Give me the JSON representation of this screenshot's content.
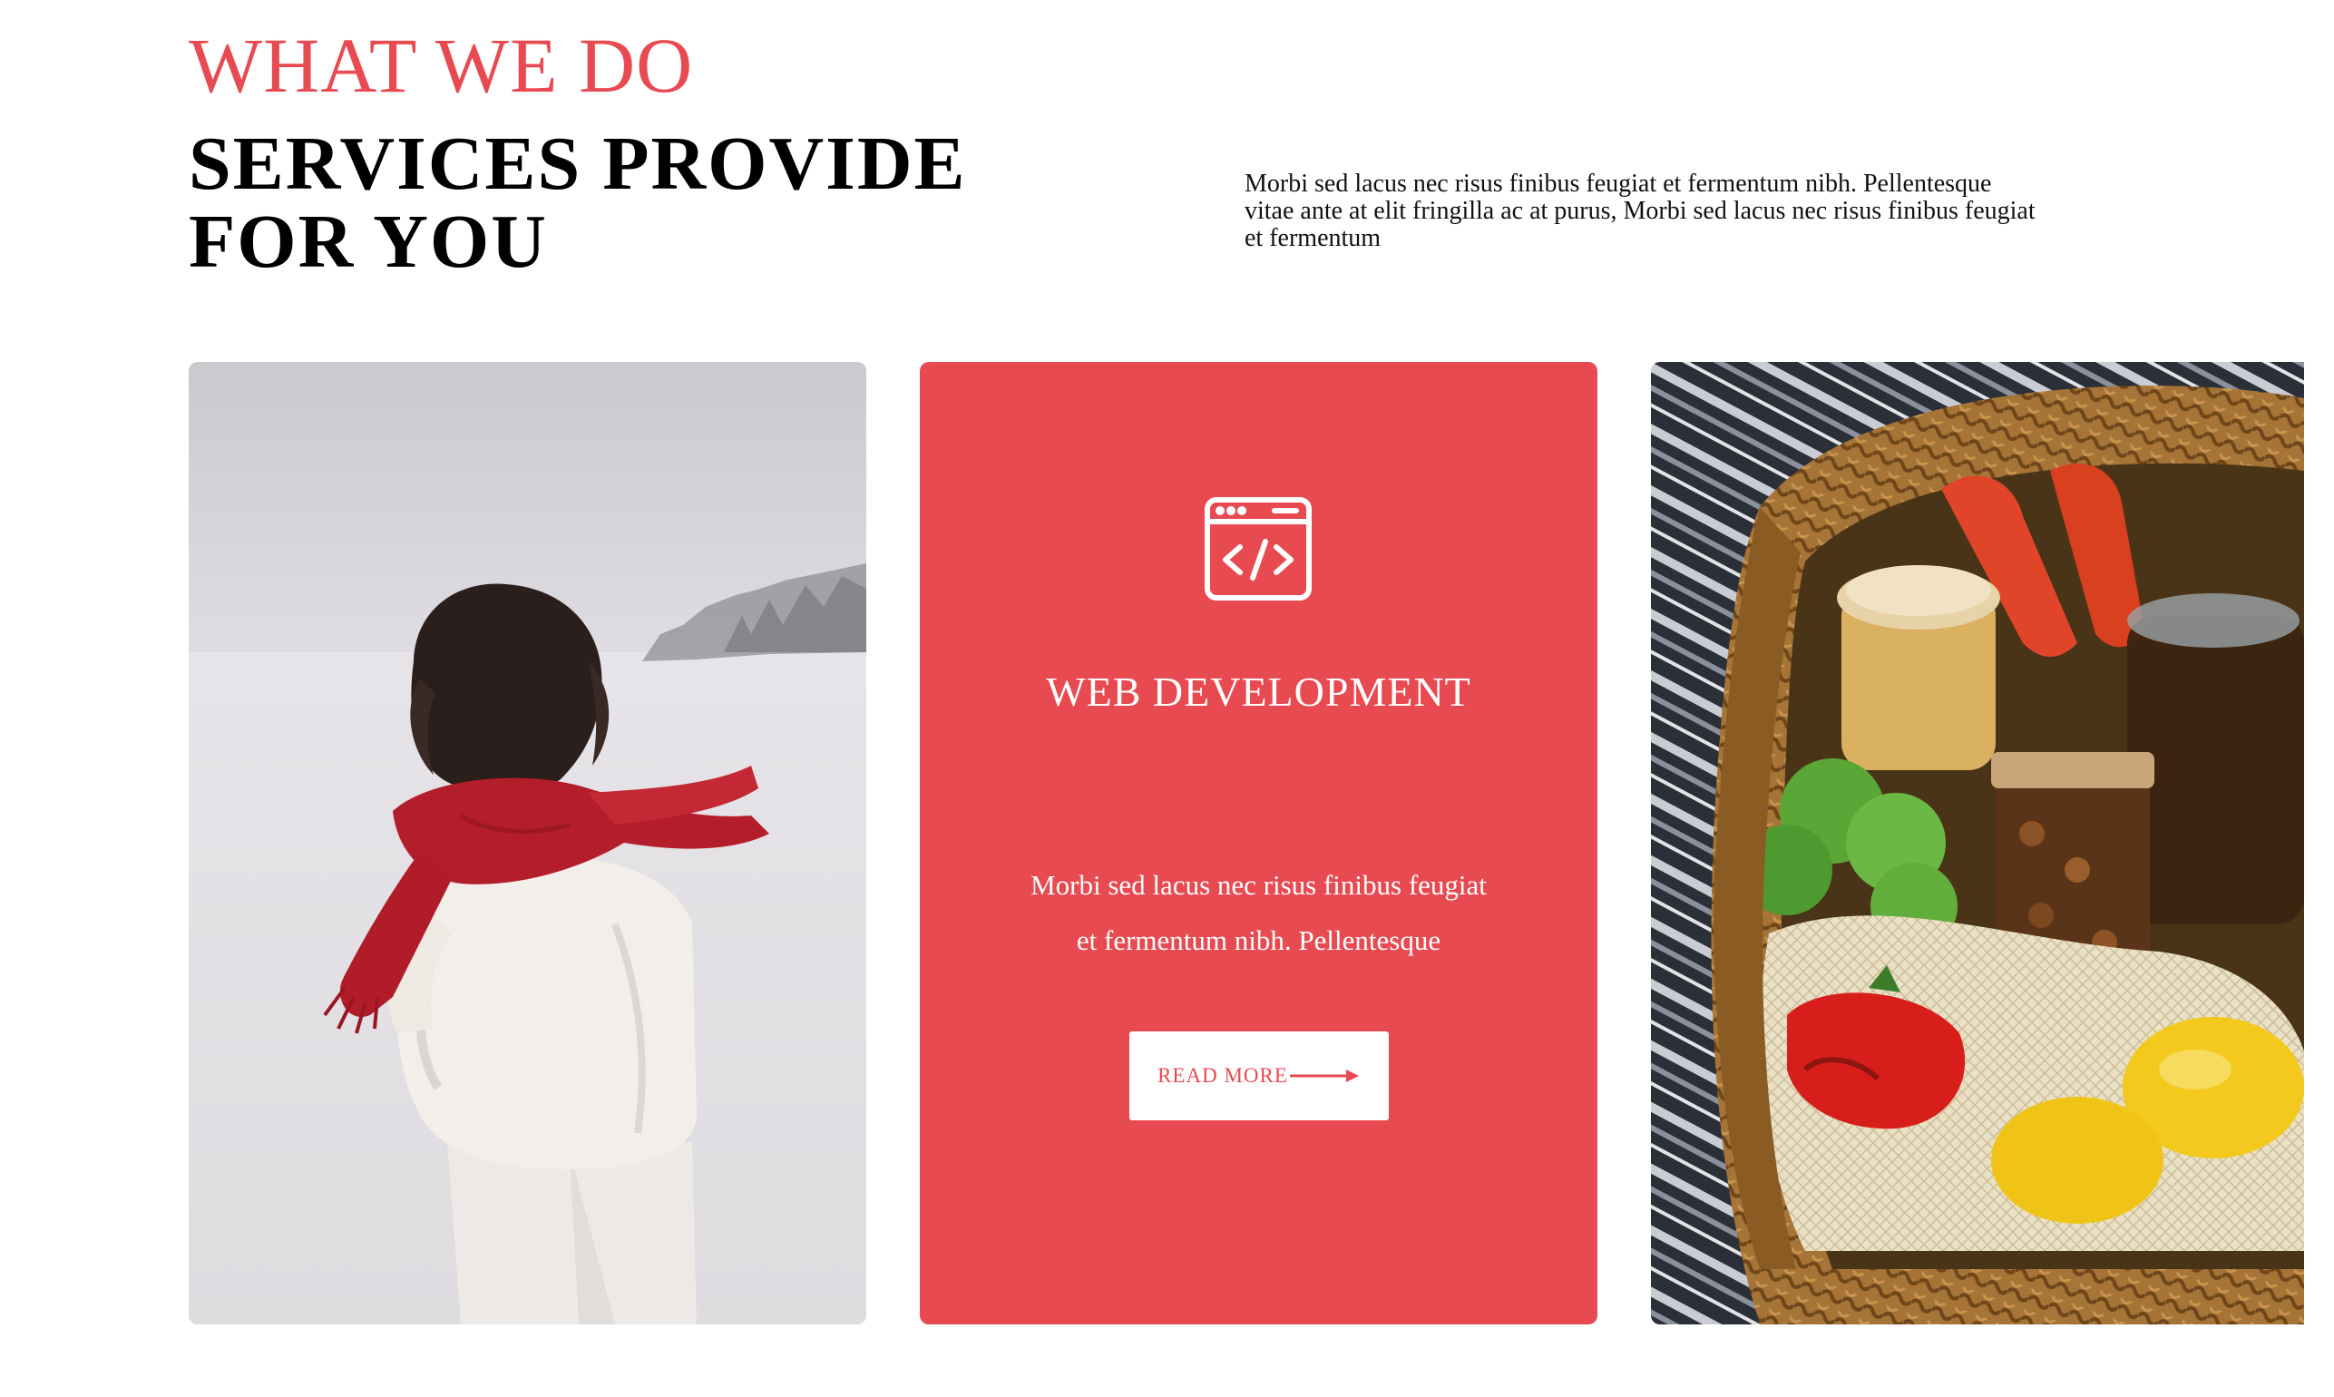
{
  "section": {
    "eyebrow": "WHAT WE DO",
    "heading_line1": "SERVICES PROVIDE",
    "heading_line2": "FOR YOU",
    "intro": "Morbi sed lacus nec risus finibus feugiat et fermentum nibh. Pellentesque vitae ante at elit fringilla ac at purus, Morbi sed lacus nec risus finibus feugiat et fermentum"
  },
  "cards": [
    {
      "type": "image",
      "image": "woman-red-scarf-snow-photo"
    },
    {
      "type": "service",
      "icon": "code-window-icon",
      "title": "WEB DEVELOPMENT",
      "text_line1": "Morbi sed lacus nec risus finibus feugiat",
      "text_line2": "et fermentum nibh. Pellentesque",
      "button_label": "READ MORE",
      "button_icon": "arrow-right-icon"
    },
    {
      "type": "image",
      "image": "wicker-basket-groceries-photo"
    }
  ],
  "colors": {
    "accent": "#e84a51",
    "background": "#ffffff",
    "heading": "#000000"
  }
}
